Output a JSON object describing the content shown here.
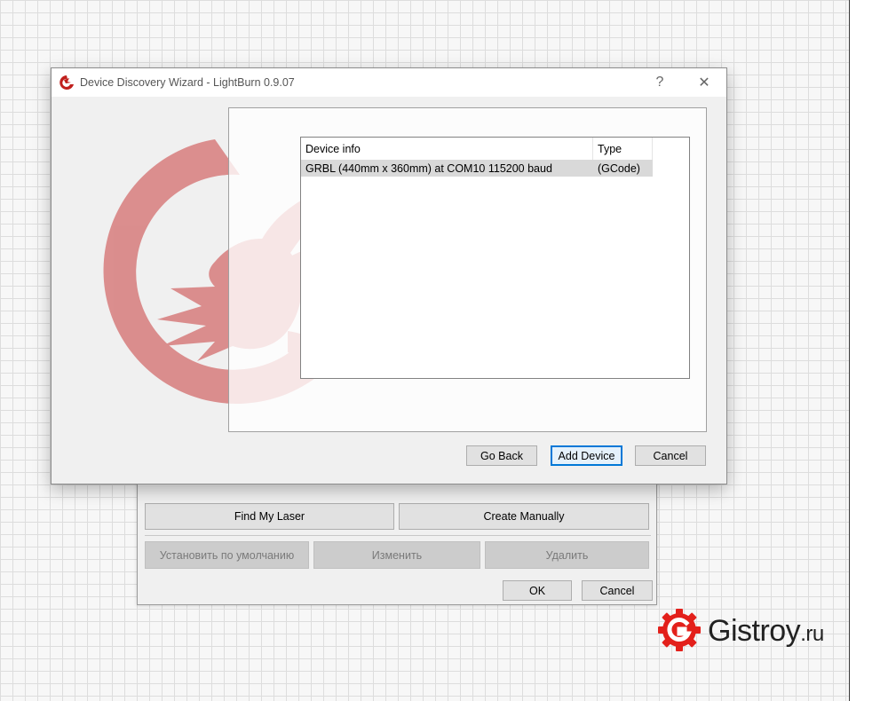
{
  "wizard": {
    "title": "Device Discovery Wizard - LightBurn 0.9.07",
    "help_glyph": "?",
    "close_glyph": "✕",
    "list": {
      "columns": [
        "Device info",
        "Type"
      ],
      "rows": [
        {
          "device_info": "GRBL (440mm x 360mm) at COM10 115200 baud",
          "type": "(GCode)"
        }
      ]
    },
    "buttons": {
      "go_back": "Go Back",
      "add_device": "Add Device",
      "cancel": "Cancel"
    }
  },
  "devices_dialog": {
    "find_my_laser": "Find My Laser",
    "create_manually": "Create Manually",
    "set_default": "Установить по умолчанию",
    "edit": "Изменить",
    "delete": "Удалить",
    "ok": "OK",
    "cancel": "Cancel"
  },
  "brand": {
    "name": "Gistroy",
    "tld": ".ru",
    "accent_color": "#e3201b",
    "watermark_color": "#d98585"
  }
}
